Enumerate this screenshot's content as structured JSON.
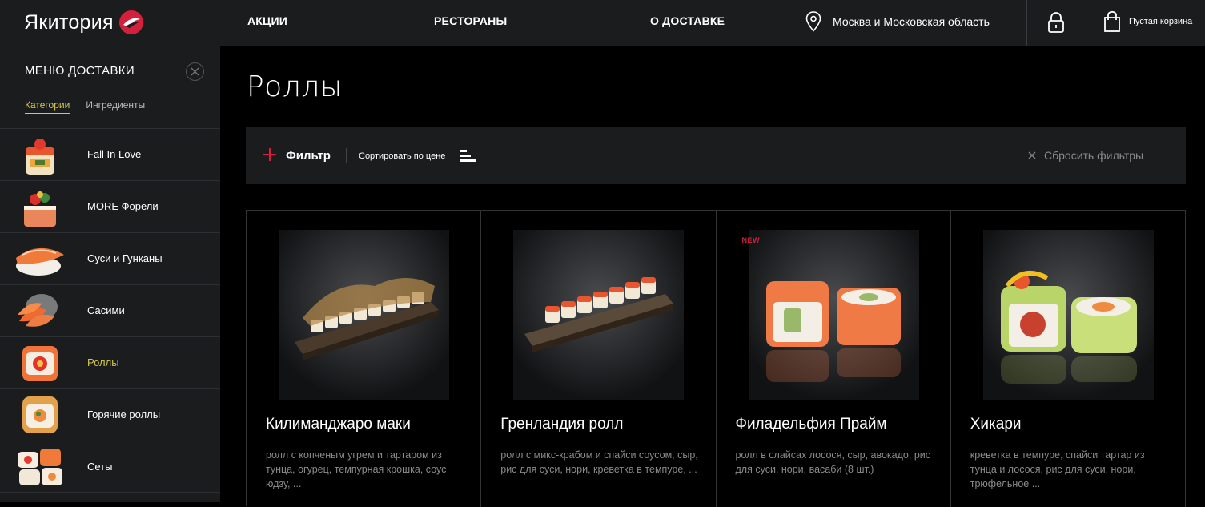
{
  "header": {
    "logo": "Якитория",
    "nav": [
      "АКЦИИ",
      "РЕСТОРАНЫ",
      "О ДОСТАВКЕ"
    ],
    "location": "Москва и Московская область",
    "cart_label": "Пустая корзина"
  },
  "sidebar": {
    "title": "МЕНЮ ДОСТАВКИ",
    "tabs": [
      "Категории",
      "Ингредиенты"
    ],
    "categories": [
      {
        "label": "Fall In Love"
      },
      {
        "label": "MORE Форели"
      },
      {
        "label": "Суси и Гунканы"
      },
      {
        "label": "Сасими"
      },
      {
        "label": "Роллы"
      },
      {
        "label": "Горячие роллы"
      },
      {
        "label": "Сеты"
      }
    ]
  },
  "main": {
    "title": "Роллы",
    "filter_label": "Фильтр",
    "sort_label": "Сортировать по цене",
    "reset_label": "Сбросить фильтры",
    "products": [
      {
        "name": "Килиманджаро маки",
        "desc": "ролл с копченым угрем и тартаром из тунца, огурец, темпурная крошка, соус юдзу, ...",
        "badge": ""
      },
      {
        "name": "Гренландия ролл",
        "desc": "ролл с микс-крабом и спайси соусом, сыр, рис для суси, нори, креветка в темпуре, ...",
        "badge": ""
      },
      {
        "name": "Филадельфия Прайм",
        "desc": "ролл в слайсах лосося, сыр, авокадо, рис для суси, нори, васаби (8 шт.)",
        "badge": "NEW"
      },
      {
        "name": "Хикари",
        "desc": "креветка в темпуре, спайси тартар из тунца и лосося, рис для суси, нори, трюфельное ...",
        "badge": ""
      }
    ]
  },
  "colors": {
    "accent_yellow": "#d4c84a",
    "brand_red": "#d3203c",
    "panel": "#1b1c1e",
    "background": "#000000"
  }
}
